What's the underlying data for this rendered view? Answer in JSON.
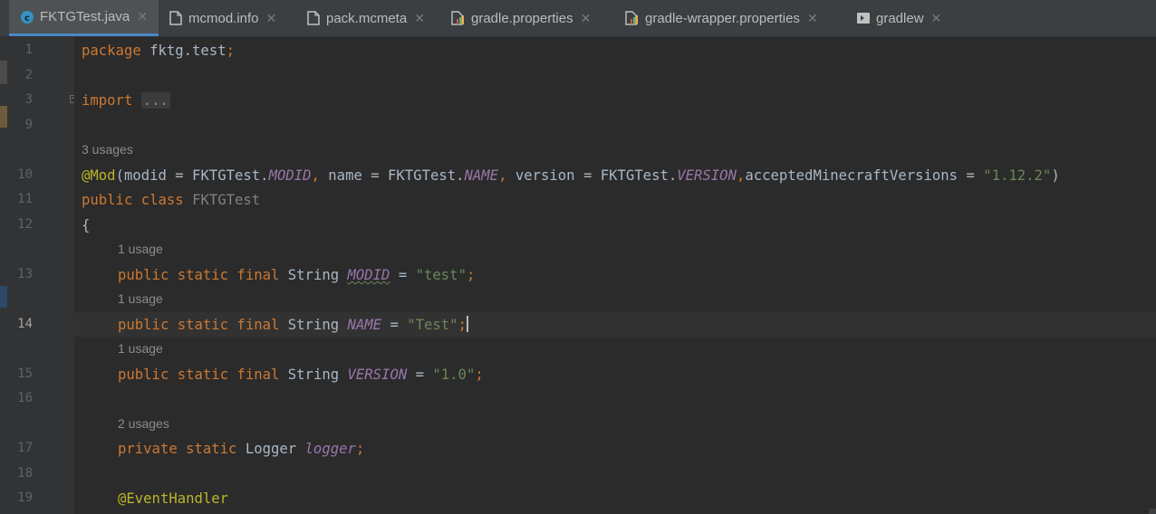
{
  "tabs": [
    {
      "label": "FKTGTest.java",
      "icon": "java-class-icon",
      "active": true
    },
    {
      "label": "mcmod.info",
      "icon": "file-icon",
      "active": false
    },
    {
      "label": "pack.mcmeta",
      "icon": "file-icon",
      "active": false
    },
    {
      "label": "gradle.properties",
      "icon": "properties-file-icon",
      "active": false
    },
    {
      "label": "gradle-wrapper.properties",
      "icon": "properties-file-icon",
      "active": false
    },
    {
      "label": "gradlew",
      "icon": "shell-script-icon",
      "active": false
    }
  ],
  "editor": {
    "line_numbers": [
      "1",
      "2",
      "3",
      "9",
      "10",
      "11",
      "12",
      "13",
      "14",
      "15",
      "16",
      "17",
      "18",
      "19"
    ],
    "current_line": "14",
    "hints": {
      "h_mod": "3 usages",
      "h_modid": "1 usage",
      "h_name": "1 usage",
      "h_version": "1 usage",
      "h_logger": "2 usages"
    },
    "code": {
      "l1_kw": "package",
      "l1_rest": " fktg.test",
      "l1_semi": ";",
      "l3_kw": "import",
      "l3_fold": "...",
      "l10_ann": "@Mod",
      "l10_a": "(modid = FKTGTest.",
      "l10_c1": "MODID",
      "l10_comma1": ",",
      "l10_b": " name = FKTGTest.",
      "l10_c2": "NAME",
      "l10_comma2": ",",
      "l10_d": " version = FKTGTest.",
      "l10_c3": "VERSION",
      "l10_comma3": ",",
      "l10_e": "acceptedMinecraftVersions = ",
      "l10_str": "\"1.12.2\"",
      "l10_end": ")",
      "l11_kw": "public class",
      "l11_cls": "FKTGTest",
      "l12_brace": "{",
      "l13_kw": "public static final",
      "l13_type": " String ",
      "l13_const": "MODID",
      "l13_eq": " = ",
      "l13_str": "\"test\"",
      "l13_semi": ";",
      "l14_kw": "public static final",
      "l14_type": " String ",
      "l14_const": "NAME",
      "l14_eq": " = ",
      "l14_str": "\"Test\"",
      "l14_semi": ";",
      "l15_kw": "public static final",
      "l15_type": " String ",
      "l15_const": "VERSION",
      "l15_eq": " = ",
      "l15_str": "\"1.0\"",
      "l15_semi": ";",
      "l17_kw": "private static",
      "l17_type": " Logger ",
      "l17_const": "logger",
      "l17_semi": ";",
      "l19_ann": "@EventHandler"
    }
  },
  "colors": {
    "keyword": "#cc7832",
    "annotation": "#bbb529",
    "string": "#6a8759",
    "constant": "#9876aa",
    "text": "#a9b7c6",
    "tab_accent": "#4a88c7"
  }
}
